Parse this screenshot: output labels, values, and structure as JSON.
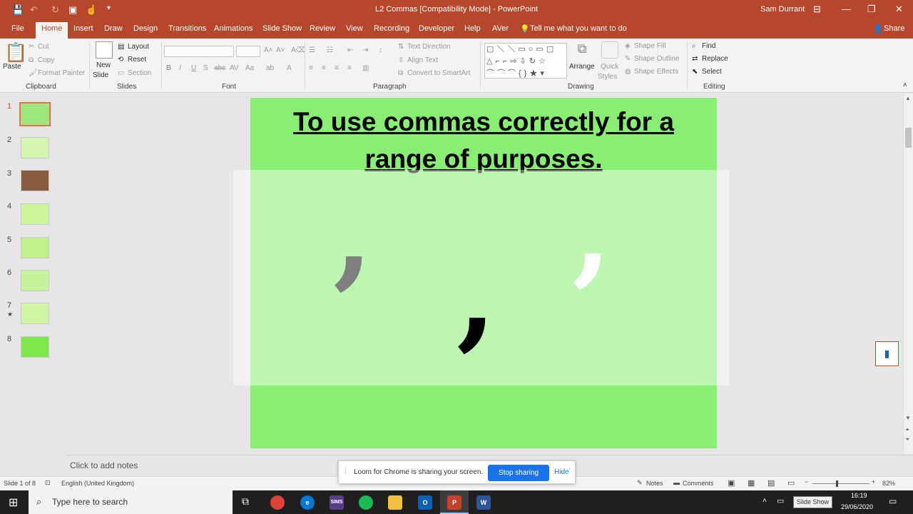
{
  "title_bar": {
    "title": "L2 Commas  [Compatibility Mode]  -  PowerPoint",
    "user": "Sam Durrant",
    "qat_icons": [
      "save-icon",
      "undo-icon",
      "redo-icon",
      "present-icon",
      "touch-mode-icon",
      "customize-icon"
    ],
    "window_controls": [
      "ribbon-display-icon",
      "minimize-icon",
      "restore-icon",
      "close-icon"
    ]
  },
  "tabs": [
    {
      "label": "File",
      "active": false
    },
    {
      "label": "Home",
      "active": true
    },
    {
      "label": "Insert",
      "active": false
    },
    {
      "label": "Draw",
      "active": false
    },
    {
      "label": "Design",
      "active": false
    },
    {
      "label": "Transitions",
      "active": false
    },
    {
      "label": "Animations",
      "active": false
    },
    {
      "label": "Slide Show",
      "active": false
    },
    {
      "label": "Review",
      "active": false
    },
    {
      "label": "View",
      "active": false
    },
    {
      "label": "Recording",
      "active": false
    },
    {
      "label": "Developer",
      "active": false
    },
    {
      "label": "Help",
      "active": false
    },
    {
      "label": "AVer",
      "active": false
    }
  ],
  "tell_me": "Tell me what you want to do",
  "share_label": "Share",
  "ribbon": {
    "clipboard": {
      "paste": "Paste",
      "cut": "Cut",
      "copy": "Copy",
      "format_painter": "Format Painter",
      "group": "Clipboard"
    },
    "slides": {
      "new_slide_1": "New",
      "new_slide_2": "Slide",
      "layout": "Layout",
      "reset": "Reset",
      "section": "Section",
      "group": "Slides"
    },
    "font": {
      "group": "Font"
    },
    "paragraph": {
      "text_direction": "Text Direction",
      "align_text": "Align Text",
      "convert_smartart": "Convert to SmartArt",
      "group": "Paragraph"
    },
    "drawing": {
      "arrange": "Arrange",
      "quick_styles_1": "Quick",
      "quick_styles_2": "Styles",
      "shape_fill": "Shape Fill",
      "shape_outline": "Shape Outline",
      "shape_effects": "Shape Effects",
      "group": "Drawing"
    },
    "editing": {
      "find": "Find",
      "replace": "Replace",
      "select": "Select",
      "group": "Editing"
    }
  },
  "thumbnails": [
    {
      "num": "1",
      "selected": true,
      "star": false
    },
    {
      "num": "2",
      "selected": false,
      "star": false
    },
    {
      "num": "3",
      "selected": false,
      "star": false
    },
    {
      "num": "4",
      "selected": false,
      "star": false
    },
    {
      "num": "5",
      "selected": false,
      "star": false
    },
    {
      "num": "6",
      "selected": false,
      "star": false
    },
    {
      "num": "7",
      "selected": false,
      "star": true
    },
    {
      "num": "8",
      "selected": false,
      "star": false
    }
  ],
  "slide": {
    "title_line1": "To use commas correctly for a",
    "title_line2": "range of purposes.",
    "background": "#88ee74",
    "commas": [
      {
        "glyph": ",",
        "color": "#7f7f7f"
      },
      {
        "glyph": ",",
        "color": "#000000"
      },
      {
        "glyph": ",",
        "color": "#ffffff"
      }
    ]
  },
  "notes_placeholder": "Click to add notes",
  "status": {
    "slide_count": "Slide 1 of 8",
    "language": "English (United Kingdom)",
    "notes": "Notes",
    "comments": "Comments",
    "zoom": "82%",
    "zoom_level": 0.82,
    "slideshow_tooltip": "Slide Show"
  },
  "loom": {
    "message": "Loom for Chrome is sharing your screen.",
    "stop": "Stop sharing",
    "hide": "Hide"
  },
  "taskbar": {
    "search_placeholder": "Type here to search",
    "time": "16:19",
    "date": "29/06/2020",
    "apps": [
      "task-view-icon",
      "chrome-icon",
      "edge-icon",
      "sims-icon",
      "spotify-icon",
      "file-explorer-icon",
      "outlook-icon",
      "powerpoint-icon",
      "word-icon"
    ],
    "sims_label": "SIMS"
  },
  "colors": {
    "accent": "#b7472a",
    "slide_green": "#88ee74",
    "loom_blue": "#1a73e8"
  }
}
